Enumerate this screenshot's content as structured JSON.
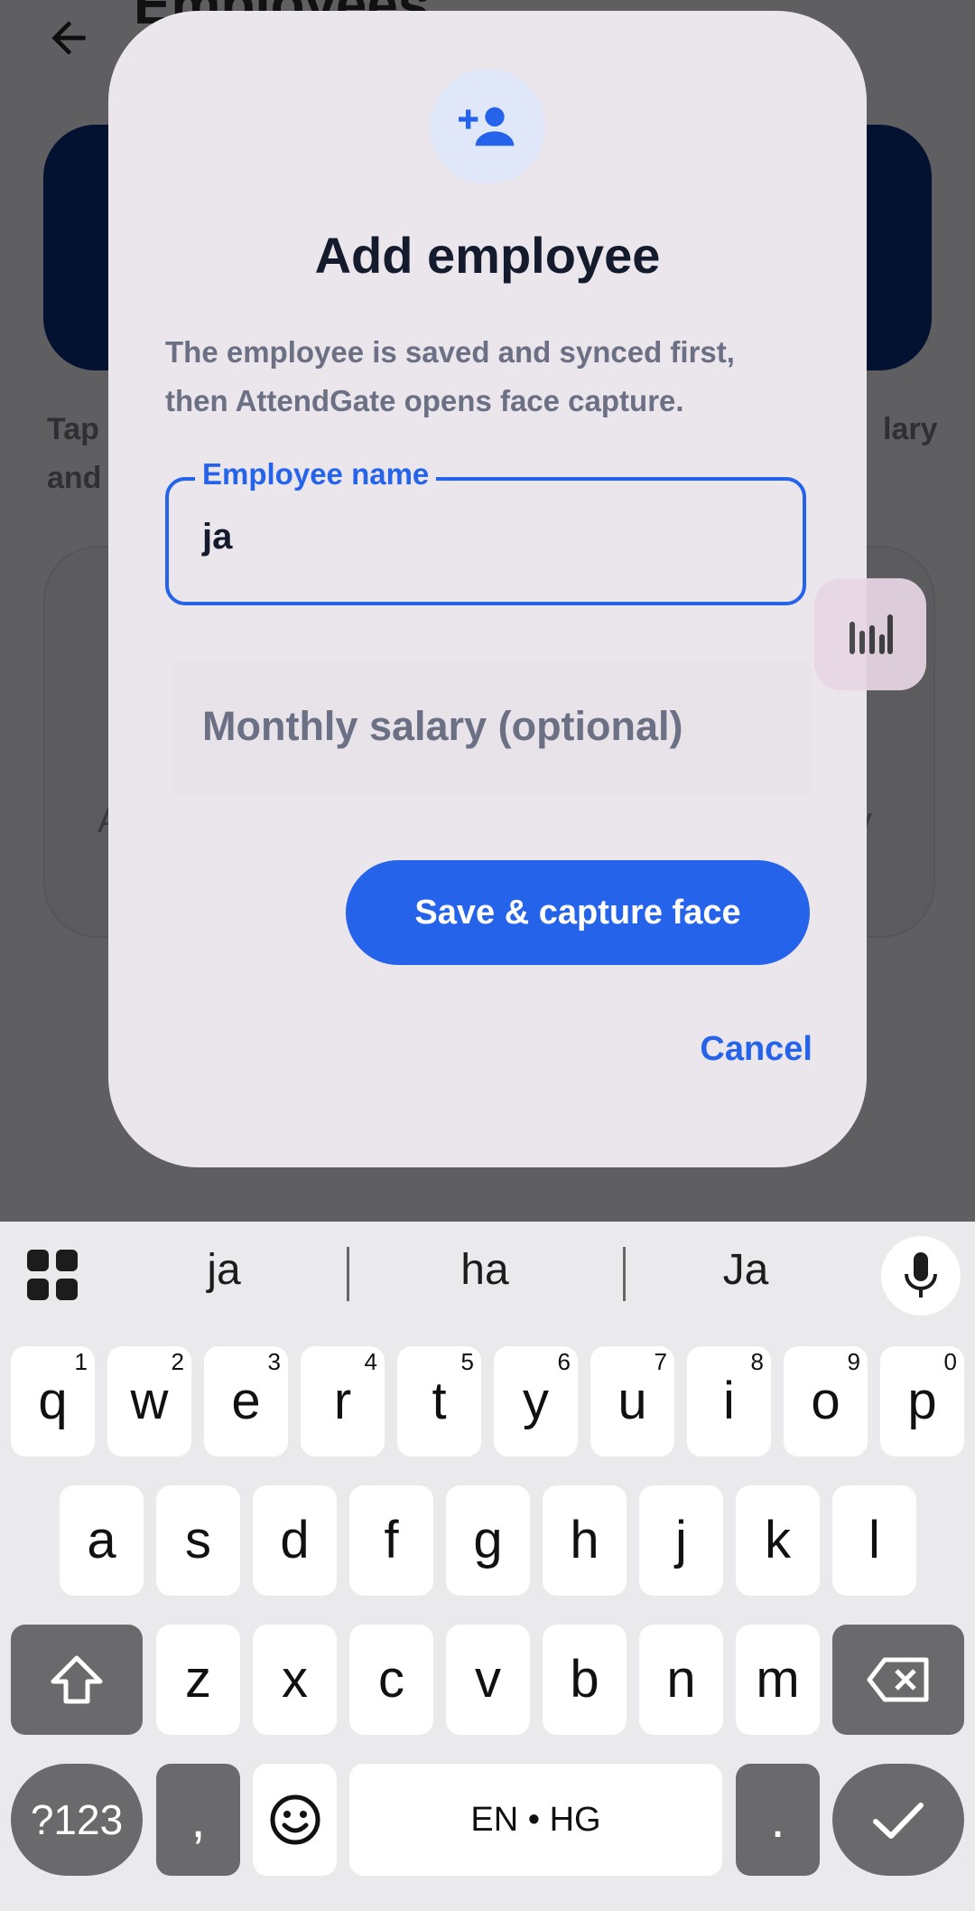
{
  "background": {
    "title": "Employees",
    "hint_left_1": "Tap",
    "hint_left_2": "and",
    "hint_right": "lary",
    "panel_left_char": "A",
    "panel_right_char": "y"
  },
  "dialog": {
    "icon": "person-add-icon",
    "title": "Add employee",
    "description_line1": "The employee is saved and synced first,",
    "description_line2": "then AttendGate opens face capture.",
    "name_field": {
      "label": "Employee name",
      "value": "ja"
    },
    "salary_field": {
      "placeholder": "Monthly salary (optional)"
    },
    "save_button": "Save & capture face",
    "cancel_button": "Cancel"
  },
  "keyboard": {
    "suggestions": [
      "ja",
      "ha",
      "Ja"
    ],
    "row1": [
      {
        "key": "q",
        "num": "1"
      },
      {
        "key": "w",
        "num": "2"
      },
      {
        "key": "e",
        "num": "3"
      },
      {
        "key": "r",
        "num": "4"
      },
      {
        "key": "t",
        "num": "5"
      },
      {
        "key": "y",
        "num": "6"
      },
      {
        "key": "u",
        "num": "7"
      },
      {
        "key": "i",
        "num": "8"
      },
      {
        "key": "o",
        "num": "9"
      },
      {
        "key": "p",
        "num": "0"
      }
    ],
    "row2": [
      "a",
      "s",
      "d",
      "f",
      "g",
      "h",
      "j",
      "k",
      "l"
    ],
    "row3": [
      "z",
      "x",
      "c",
      "v",
      "b",
      "n",
      "m"
    ],
    "symbols_key": "?123",
    "comma_key": ",",
    "space_key": "EN • HG",
    "period_key": "."
  },
  "colors": {
    "accent": "#2563eb",
    "dialog_bg": "#ebe5ec",
    "title": "#141b2d"
  }
}
